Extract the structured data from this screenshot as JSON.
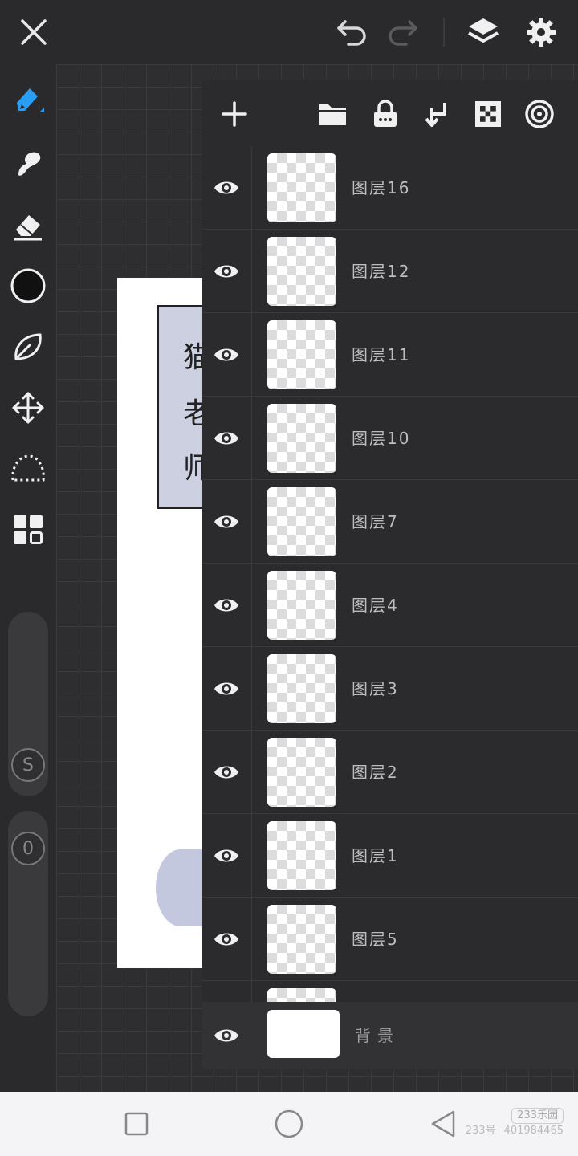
{
  "app": {
    "accent_color": "#2a9df4",
    "top_bar": {
      "icons": [
        "close-icon",
        "undo-icon",
        "redo-icon",
        "layers-icon",
        "settings-icon"
      ]
    },
    "left_toolbar": {
      "icons": [
        "pen-brush-icon",
        "smudge-icon",
        "eraser-icon",
        "color-swatch-icon",
        "leaf-icon",
        "transform-move-icon",
        "lasso-select-icon",
        "grid-menu-icon"
      ],
      "color_swatch": "#111111",
      "size_slider_label": "S",
      "opacity_slider_label": "0"
    },
    "canvas": {
      "sign_chars": [
        "猫",
        "老",
        "师"
      ]
    },
    "layer_panel": {
      "toolbar_icons": [
        "add-layer-icon",
        "folder-icon",
        "lock-icon",
        "merge-down-icon",
        "transparency-icon",
        "blend-mode-icon"
      ],
      "layers": [
        {
          "name": "图层16",
          "visible": true
        },
        {
          "name": "图层12",
          "visible": true
        },
        {
          "name": "图层11",
          "visible": true
        },
        {
          "name": "图层10",
          "visible": true
        },
        {
          "name": "图层7",
          "visible": true
        },
        {
          "name": "图层4",
          "visible": true
        },
        {
          "name": "图层3",
          "visible": true
        },
        {
          "name": "图层2",
          "visible": true
        },
        {
          "name": "图层1",
          "visible": true
        },
        {
          "name": "图层5",
          "visible": true
        }
      ],
      "background_layer": {
        "name": "背景",
        "visible": true
      }
    },
    "nav_bar": {
      "icons": [
        "recent-apps-icon",
        "home-icon",
        "back-icon"
      ],
      "watermark_top": "233乐园",
      "watermark_bottom_left": "233号",
      "watermark_bottom_right": "401984465"
    }
  }
}
